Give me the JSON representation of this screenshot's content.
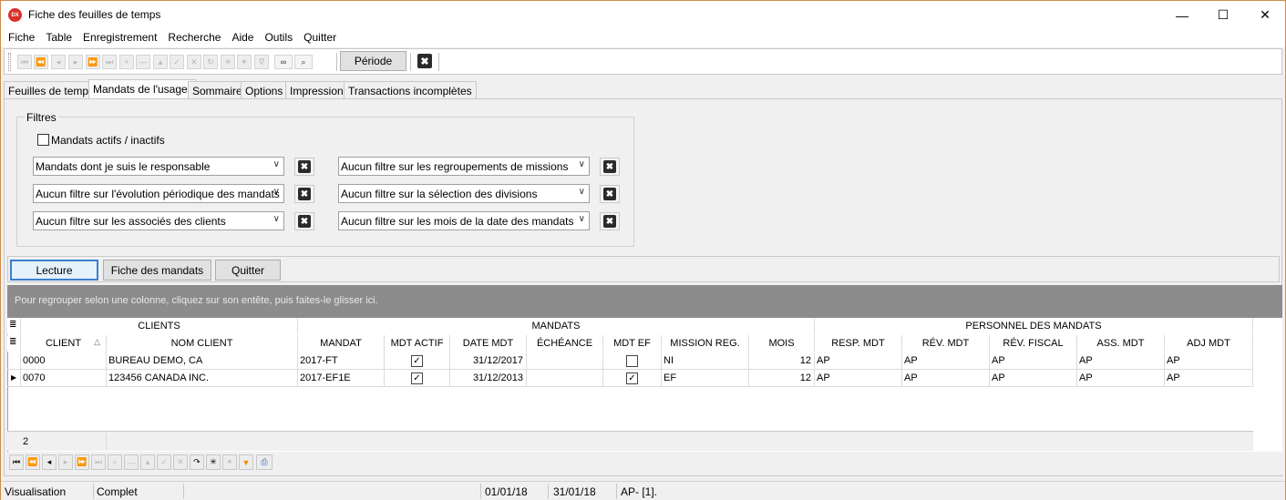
{
  "window": {
    "app_icon": "DX",
    "title": "Fiche des feuilles de temps",
    "minimize": "—",
    "maximize": "☐",
    "close": "✕"
  },
  "menu": [
    "Fiche",
    "Table",
    "Enregistrement",
    "Recherche",
    "Aide",
    "Outils",
    "Quitter"
  ],
  "toolbar": {
    "nav_icons": [
      "first-icon",
      "prev-page-icon",
      "prev-icon",
      "next-icon",
      "next-page-icon",
      "last-icon",
      "add-icon",
      "delete-icon",
      "edit-icon",
      "post-icon",
      "cancel-icon",
      "refresh-icon",
      "asterisk-icon",
      "asterisk-alt-icon",
      "filter-icon",
      "binoculars-icon",
      "magnifier-icon"
    ],
    "nav_glyphs": [
      "⏮",
      "⏪",
      "◂",
      "▸",
      "⏩",
      "⏭",
      "+",
      "—",
      "▴",
      "✓",
      "✕",
      "↻",
      "✳",
      "✴",
      "∇",
      "∞",
      "⌕"
    ],
    "periode_label": "Période",
    "close_glyph": "✖"
  },
  "tabs": [
    "Feuilles de temps",
    "Mandats de l'usager",
    "Sommaire",
    "Options",
    "Impression",
    "Transactions incomplètes"
  ],
  "active_tab": 1,
  "filters": {
    "legend": "Filtres",
    "active_checkbox_label": "Mandats actifs / inactifs",
    "active_checked": false,
    "clear_glyph": "✖",
    "arrow_glyph": "∨",
    "left": [
      "Mandats dont je suis le responsable",
      "Aucun filtre sur l'évolution périodique des mandats",
      "Aucun filtre sur les associés des clients"
    ],
    "right": [
      "Aucun filtre sur les regroupements de missions",
      "Aucun filtre sur la sélection des divisions",
      "Aucun filtre sur les mois de la date des mandats"
    ]
  },
  "buttons": {
    "lecture": "Lecture",
    "fiche_mandats": "Fiche des mandats",
    "quitter": "Quitter"
  },
  "grid": {
    "group_hint": "Pour regrouper selon une colonne, cliquez sur son entête, puis faites-le glisser ici.",
    "band_glyph": "≣",
    "sort_glyph": "△",
    "bands": [
      "CLIENTS",
      "MANDATS",
      "PERSONNEL DES MANDATS"
    ],
    "columns": [
      "CLIENT",
      "NOM CLIENT",
      "MANDAT",
      "MDT ACTIF",
      "DATE MDT",
      "ÉCHÉANCE",
      "MDT EF",
      "MISSION REG.",
      "MOIS",
      "RESP. MDT",
      "RÉV. MDT",
      "RÉV. FISCAL",
      "ASS. MDT",
      "ADJ MDT"
    ],
    "rows": [
      {
        "client": "0000",
        "nom": "BUREAU DEMO, CA",
        "mandat": "2017-FT",
        "actif": true,
        "date": "31/12/2017",
        "echeance": "",
        "ef": false,
        "mission": "NI",
        "mois": "12",
        "resp": "AP",
        "rev": "AP",
        "fiscal": "AP",
        "ass": "AP",
        "adj": "AP",
        "current": false
      },
      {
        "client": "0070",
        "nom": "123456 CANADA INC.",
        "mandat": "2017-EF1E",
        "actif": true,
        "date": "31/12/2013",
        "echeance": "",
        "ef": true,
        "mission": "EF",
        "mois": "12",
        "resp": "AP",
        "rev": "AP",
        "fiscal": "AP",
        "ass": "AP",
        "adj": "AP",
        "current": true
      }
    ],
    "footer_count": "2",
    "current_row_glyph": "▶",
    "check_glyph": "✓"
  },
  "navigator": {
    "icons": [
      "first-icon",
      "prev-page-icon",
      "prev-icon",
      "next-icon",
      "next-page-icon",
      "last-icon",
      "insert-icon",
      "delete-icon",
      "edit-icon",
      "post-icon",
      "cancel-icon",
      "refresh-icon",
      "asterisk-icon",
      "asterisk-alt-icon",
      "filter-icon",
      "print-icon"
    ],
    "glyphs": [
      "⏮",
      "⏪",
      "◂",
      "▸",
      "⏩",
      "⏭",
      "+",
      "—",
      "▴",
      "✓",
      "✕",
      "↷",
      "✳",
      "✴",
      "▼",
      "⎙"
    ],
    "disabled": [
      false,
      false,
      false,
      true,
      true,
      true,
      true,
      true,
      true,
      true,
      true,
      false,
      false,
      true,
      false,
      false
    ]
  },
  "status": {
    "mode": "Visualisation",
    "state": "Complet",
    "date_from": "01/01/18",
    "date_to": "31/01/18",
    "user": "AP- [1]."
  },
  "colors": {
    "accent_border": "#d08b4c",
    "app_icon_red": "#d9302a",
    "group_bar": "#8c8c8c",
    "filter_orange": "#f08a00",
    "print_blue": "#1a5fb4"
  }
}
